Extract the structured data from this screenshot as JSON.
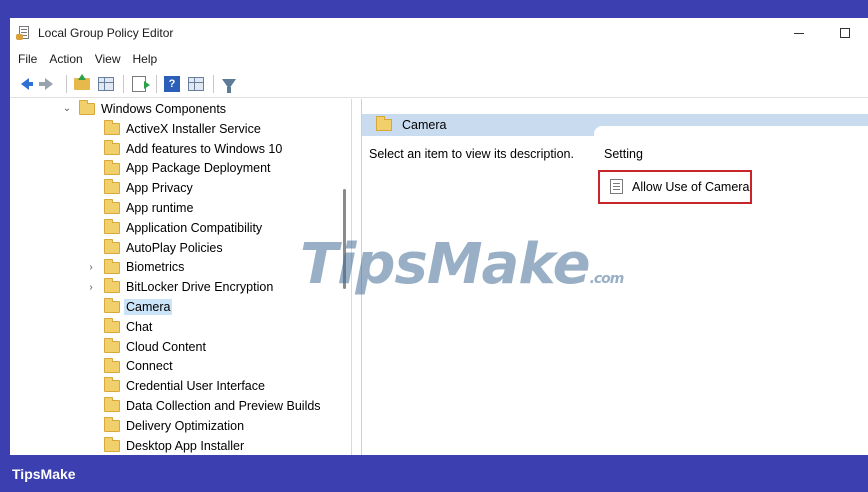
{
  "window": {
    "title": "Local Group Policy Editor"
  },
  "menu": [
    "File",
    "Action",
    "View",
    "Help"
  ],
  "toolbar": {
    "buttons": [
      "back-icon",
      "forward-icon",
      "up-folder-icon",
      "show-hide-tree-icon",
      "export-list-icon",
      "help-icon",
      "properties-icon",
      "filter-icon"
    ]
  },
  "tree": {
    "parent": "Windows Components",
    "items": [
      {
        "label": "ActiveX Installer Service",
        "expandable": false
      },
      {
        "label": "Add features to Windows 10",
        "expandable": false
      },
      {
        "label": "App Package Deployment",
        "expandable": false
      },
      {
        "label": "App Privacy",
        "expandable": false
      },
      {
        "label": "App runtime",
        "expandable": false
      },
      {
        "label": "Application Compatibility",
        "expandable": false
      },
      {
        "label": "AutoPlay Policies",
        "expandable": false
      },
      {
        "label": "Biometrics",
        "expandable": true
      },
      {
        "label": "BitLocker Drive Encryption",
        "expandable": true
      },
      {
        "label": "Camera",
        "expandable": false,
        "selected": true
      },
      {
        "label": "Chat",
        "expandable": false
      },
      {
        "label": "Cloud Content",
        "expandable": false
      },
      {
        "label": "Connect",
        "expandable": false
      },
      {
        "label": "Credential User Interface",
        "expandable": false
      },
      {
        "label": "Data Collection and Preview Builds",
        "expandable": false
      },
      {
        "label": "Delivery Optimization",
        "expandable": false
      },
      {
        "label": "Desktop App Installer",
        "expandable": false
      }
    ]
  },
  "details": {
    "header": "Camera",
    "description": "Select an item to view its description.",
    "column_header": "Setting",
    "setting": "Allow Use of Camera",
    "highlight_color": "#c8252b"
  },
  "watermark": {
    "text": "TipsMake",
    "suffix": ".com"
  },
  "footer": {
    "brand": "TipsMake"
  }
}
